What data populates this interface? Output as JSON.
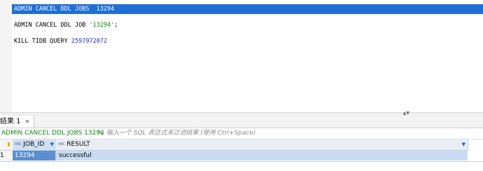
{
  "editor": {
    "lines": [
      "ADMIN CANCEL DDL JOBS  13294",
      "ADMIN CANCEL DDL JOB ",
      "'13294'",
      ";",
      "KILL TIDB QUERY ",
      "2597972072"
    ]
  },
  "results": {
    "tab_label": "结果 1",
    "tab_close": "✕",
    "query_text": "ADMIN CANCEL DDL JOBS 13294",
    "filter_placeholder": "输入一个 SQL 表达式来过滤结果 (使用 Ctrl+Space)",
    "columns": [
      {
        "name": "JOB_ID",
        "type_badge": "ABC"
      },
      {
        "name": "RESULT",
        "type_badge": "ABC"
      }
    ],
    "rows": [
      {
        "row_num": "1",
        "job_id": "13294",
        "result": "successful"
      }
    ]
  },
  "colors": {
    "selection": "#1f6fd6",
    "string": "#0a8a0a",
    "number": "#1b2fd6"
  }
}
